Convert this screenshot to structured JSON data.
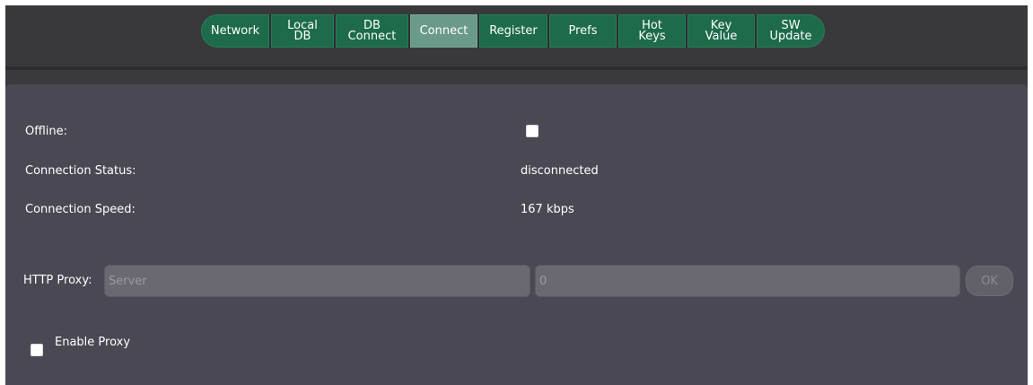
{
  "tabs": [
    {
      "label": "Network"
    },
    {
      "label": "Local\nDB"
    },
    {
      "label": "DB\nConnect"
    },
    {
      "label": "Connect"
    },
    {
      "label": "Register"
    },
    {
      "label": "Prefs"
    },
    {
      "label": "Hot\nKeys"
    },
    {
      "label": "Key\nValue"
    },
    {
      "label": "SW\nUpdate"
    }
  ],
  "active_tab": "Connect",
  "settings": {
    "offline_label": "Offline:",
    "offline_checked": false,
    "status_label": "Connection Status:",
    "status_value": "disconnected",
    "speed_label": "Connection Speed:",
    "speed_value": "167 kbps"
  },
  "proxy": {
    "label": "HTTP Proxy:",
    "server_placeholder": "Server",
    "port_placeholder": "0",
    "ok_label": "OK",
    "enable_label": "Enable Proxy",
    "enable_checked": false
  }
}
